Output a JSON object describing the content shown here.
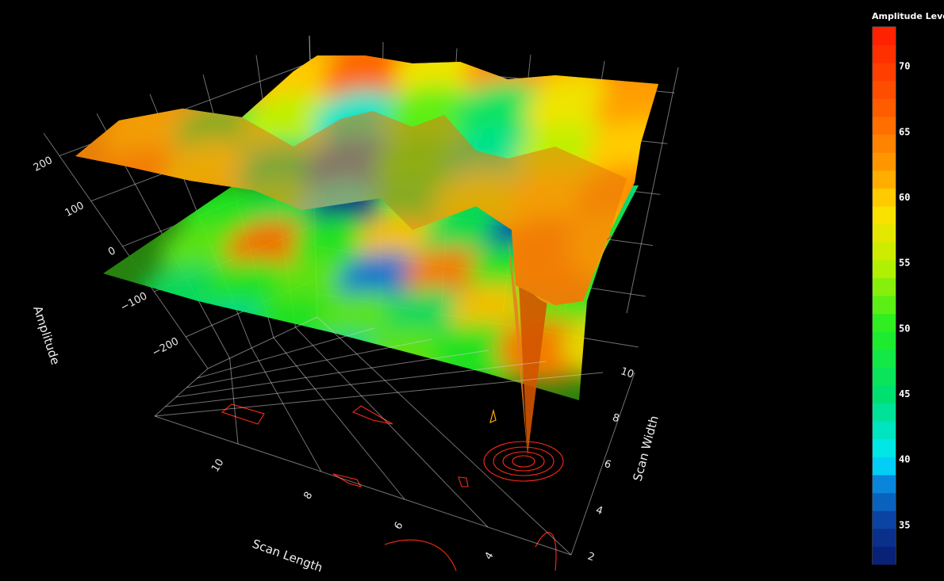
{
  "chart_data": {
    "type": "surface3d",
    "axes": {
      "x": {
        "label": "Scan Length",
        "ticks": [
          "4",
          "6",
          "8",
          "10"
        ]
      },
      "y": {
        "label": "Scan Width",
        "ticks": [
          "2",
          "4",
          "6",
          "8",
          "10"
        ]
      },
      "z": {
        "label": "Amplitude",
        "ticks": [
          "200",
          "100",
          "0",
          "−100",
          "−200"
        ],
        "range": [
          -250,
          250
        ]
      }
    },
    "surfaces": [
      {
        "kind": "upper surface",
        "colorscale": "amplitude",
        "grid": [
          [
            62,
            64,
            60,
            66,
            58,
            63,
            61,
            65
          ],
          [
            60,
            48,
            55,
            42,
            52,
            46,
            58,
            62
          ],
          [
            64,
            58,
            45,
            38,
            50,
            44,
            55,
            60
          ],
          [
            66,
            62,
            52,
            40,
            48,
            56,
            60,
            63
          ],
          [
            63,
            65,
            58,
            54,
            60,
            62,
            64,
            61
          ]
        ]
      },
      {
        "kind": "lower plane",
        "colorscale": "amplitude",
        "grid": [
          [
            50,
            48,
            34,
            52,
            46,
            50,
            44,
            48
          ],
          [
            52,
            65,
            50,
            60,
            47,
            36,
            50,
            45
          ],
          [
            46,
            50,
            52,
            38,
            64,
            50,
            48,
            52
          ],
          [
            48,
            44,
            50,
            52,
            46,
            60,
            52,
            50
          ],
          [
            62,
            56,
            48,
            44,
            52,
            50,
            64,
            58
          ]
        ]
      }
    ],
    "projected_contours": "red outlines on floor",
    "colorbar": {
      "title": "Amplitude Level",
      "min": 32,
      "max": 73,
      "ticks": [
        70,
        65,
        60,
        55,
        50,
        45,
        40,
        35
      ]
    }
  }
}
